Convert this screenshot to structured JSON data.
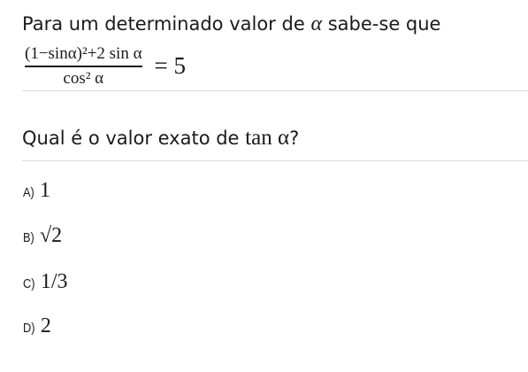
{
  "question": {
    "intro": "Para um determinado valor de",
    "intro_symbol": "α",
    "intro_end": "sabe-se que",
    "equation": {
      "numerator": "(1−sinα)²+2 sin α",
      "denominator": "cos² α",
      "rhs": "= 5"
    },
    "prompt": "Qual é o valor exato de",
    "prompt_math": "tan α",
    "prompt_end": "?"
  },
  "options": [
    {
      "label": "A)",
      "value": "1"
    },
    {
      "label": "B)",
      "value": "√2"
    },
    {
      "label": "C)",
      "value": "1/3"
    },
    {
      "label": "D)",
      "value": "2"
    }
  ]
}
